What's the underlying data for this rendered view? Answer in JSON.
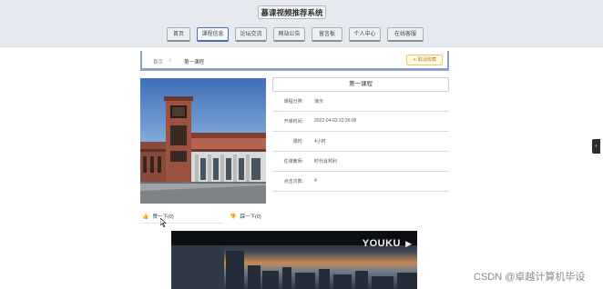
{
  "header": {
    "site_title": "慕课视频推荐系统",
    "nav": [
      {
        "label": "首页"
      },
      {
        "label": "课程信息",
        "active": true
      },
      {
        "label": "论坛交流"
      },
      {
        "label": "网站公告"
      },
      {
        "label": "留言板"
      },
      {
        "label": "个人中心"
      },
      {
        "label": "在线客服"
      }
    ]
  },
  "breadcrumb": {
    "home": "首页",
    "sep": "/",
    "current": "第一课程"
  },
  "favorite_button": {
    "icon": "star-icon",
    "label": "取消收藏"
  },
  "course": {
    "title": "第一课程",
    "fields": [
      {
        "label": "课程分类:",
        "value": "演示"
      },
      {
        "label": "开课时间:",
        "value": "2022-04-03 22:36:00"
      },
      {
        "label": "课时:",
        "value": "4小时"
      },
      {
        "label": "任课教师:",
        "value": "时代肖邦利"
      },
      {
        "label": "点击次数:",
        "value": "4"
      }
    ]
  },
  "votes": {
    "up": {
      "icon": "thumb-up-icon",
      "label": "赞一下(0)"
    },
    "down": {
      "icon": "thumb-down-icon",
      "label": "踩一下(0)"
    }
  },
  "video": {
    "brand": "YOUKU"
  },
  "watermark": "CSDN @卓越计算机毕设"
}
